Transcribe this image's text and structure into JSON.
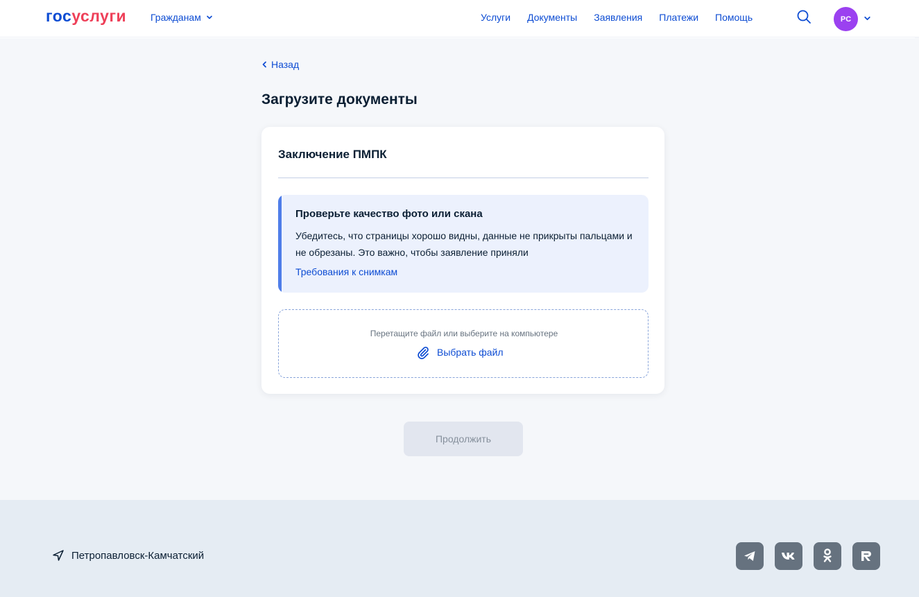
{
  "header": {
    "logo_part1": "гос",
    "logo_part2": "услуги",
    "role_menu_label": "Гражданам",
    "nav": [
      "Услуги",
      "Документы",
      "Заявления",
      "Платежи",
      "Помощь"
    ],
    "avatar_initials": "PC"
  },
  "main": {
    "back_label": "Назад",
    "page_title": "Загрузите документы",
    "card": {
      "title": "Заключение ПМПК",
      "notice": {
        "title": "Проверьте качество фото или скана",
        "text": "Убедитесь, что страницы хорошо видны, данные не прикрыты пальцами и не обрезаны. Это важно, чтобы заявление приняли",
        "link": "Требования к снимкам"
      },
      "dropzone": {
        "hint": "Перетащите файл или выберите на компьютере",
        "choose_file": "Выбрать файл"
      }
    },
    "continue_label": "Продолжить"
  },
  "footer": {
    "location": "Петропавловск-Камчатский",
    "socials": [
      "telegram-icon",
      "vk-icon",
      "odnoklassniki-icon",
      "rutube-icon"
    ]
  },
  "colors": {
    "brand_blue": "#0d4cd3",
    "brand_red": "#ee3f58",
    "avatar_bg": "#9b41f0",
    "notice_bg": "#ecf1fd",
    "notice_accent": "#4e7de9"
  }
}
